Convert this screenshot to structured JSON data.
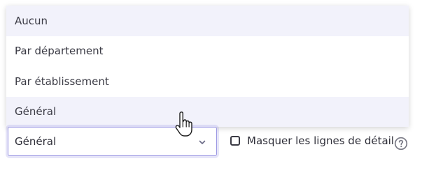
{
  "dropdown": {
    "options": [
      {
        "label": "Aucun"
      },
      {
        "label": "Par département"
      },
      {
        "label": "Par établissement"
      },
      {
        "label": "Général"
      }
    ]
  },
  "select": {
    "value": "Général",
    "icon": "chevron-down-icon"
  },
  "options_bar": {
    "hide_detail_label": "Masquer les lignes de détail",
    "hide_detail_checked": false,
    "help_icon": "question-circle-icon"
  },
  "cursor": {
    "icon": "hand-pointer-icon"
  },
  "colors": {
    "accent": "#9b97e3",
    "highlight": "#f2f2fb",
    "text": "#2e2e38"
  }
}
